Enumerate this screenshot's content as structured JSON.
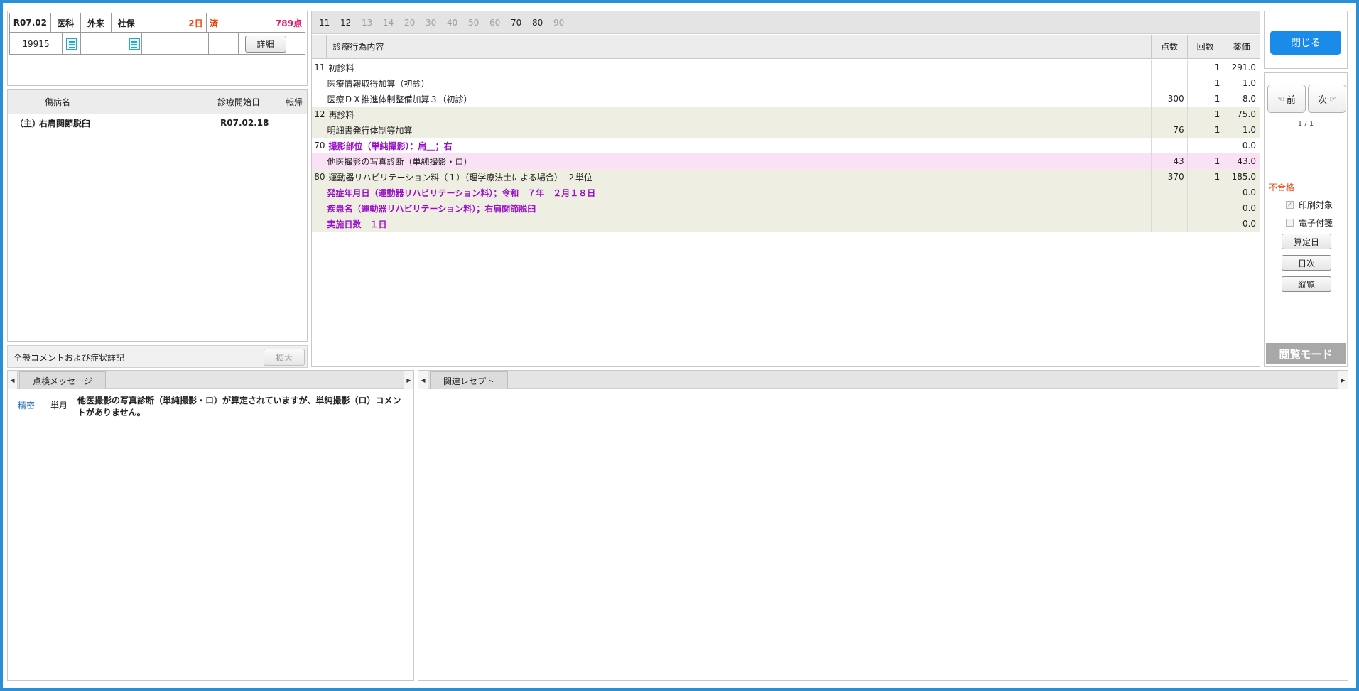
{
  "header": {
    "date": "R07.02",
    "dept": "医科",
    "visit_type": "外来",
    "insurance": "社保",
    "days": "2日",
    "status": "済",
    "points": "789点",
    "patient_id": "19915",
    "detail_label": "詳細"
  },
  "disease": {
    "columns": [
      "傷病名",
      "診療開始日",
      "転帰"
    ],
    "rows": [
      {
        "prefix": "（主）",
        "name": "右肩関節脱臼",
        "start": "R07.02.18",
        "outcome": ""
      }
    ]
  },
  "comment_bar": {
    "label": "全般コメントおよび症状詳記",
    "expand_label": "拡大"
  },
  "main": {
    "tabs": [
      {
        "label": "11",
        "enabled": true
      },
      {
        "label": "12",
        "enabled": true
      },
      {
        "label": "13",
        "enabled": false
      },
      {
        "label": "14",
        "enabled": false
      },
      {
        "label": "20",
        "enabled": false
      },
      {
        "label": "30",
        "enabled": false
      },
      {
        "label": "40",
        "enabled": false
      },
      {
        "label": "50",
        "enabled": false
      },
      {
        "label": "60",
        "enabled": false
      },
      {
        "label": "70",
        "enabled": true
      },
      {
        "label": "80",
        "enabled": true
      },
      {
        "label": "90",
        "enabled": false
      }
    ],
    "columns": {
      "content": "診療行為内容",
      "points": "点数",
      "count": "回数",
      "price": "薬価"
    },
    "rows": [
      {
        "code": "11",
        "name": "初診料",
        "points": "",
        "count": "1",
        "price": "291.0",
        "bg": "white",
        "purple": false
      },
      {
        "code": "",
        "name": "医療情報取得加算（初診）",
        "points": "",
        "count": "1",
        "price": "1.0",
        "bg": "white",
        "purple": false
      },
      {
        "code": "",
        "name": "医療ＤＸ推進体制整備加算３（初診）",
        "points": "300",
        "count": "1",
        "price": "8.0",
        "bg": "white",
        "purple": false
      },
      {
        "code": "12",
        "name": "再診料",
        "points": "",
        "count": "1",
        "price": "75.0",
        "bg": "beige",
        "purple": false
      },
      {
        "code": "",
        "name": "明細書発行体制等加算",
        "points": "76",
        "count": "1",
        "price": "1.0",
        "bg": "beige",
        "purple": false
      },
      {
        "code": "70",
        "name": "撮影部位（単純撮影）：肩＿；右",
        "points": "",
        "count": "",
        "price": "0.0",
        "bg": "white",
        "purple": true
      },
      {
        "code": "",
        "name": "他医撮影の写真診断（単純撮影・ロ）",
        "points": "43",
        "count": "1",
        "price": "43.0",
        "bg": "pink",
        "purple": false
      },
      {
        "code": "80",
        "name": "運動器リハビリテーション料（１）（理学療法士による場合）　２単位",
        "points": "370",
        "count": "1",
        "price": "185.0",
        "bg": "beige",
        "purple": false
      },
      {
        "code": "",
        "name": "発症年月日（運動器リハビリテーション料）；令和　７年　２月１８日",
        "points": "",
        "count": "",
        "price": "0.0",
        "bg": "beige",
        "purple": true
      },
      {
        "code": "",
        "name": "疾患名（運動器リハビリテーション料）；右肩関節脱臼",
        "points": "",
        "count": "",
        "price": "0.0",
        "bg": "beige",
        "purple": true
      },
      {
        "code": "",
        "name": "実施日数　１日",
        "points": "",
        "count": "",
        "price": "0.0",
        "bg": "beige",
        "purple": true
      }
    ]
  },
  "right_panel": {
    "close_label": "閉じる",
    "prev_label": "前",
    "next_label": "次",
    "page": "1 / 1",
    "fail_label": "不合格",
    "print_target_label": "印刷対象",
    "print_target_checked": true,
    "e_tag_label": "電子付箋",
    "e_tag_checked": false,
    "calc_day_label": "算定日",
    "daily_label": "日次",
    "vertical_label": "縦覧",
    "browse_mode_label": "閲覧モード"
  },
  "check_panel": {
    "tab_label": "点検メッセージ",
    "messages": [
      {
        "level": "精密",
        "scope": "単月",
        "text": "他医撮影の写真診断（単純撮影・ロ）が算定されていますが、単純撮影（ロ）コメントがありません。"
      }
    ]
  },
  "related_panel": {
    "tab_label": "関連レセプト"
  },
  "colors": {
    "frame": "#2b8fd6",
    "accent_red": "#e8450a",
    "points_pink": "#e01a6e",
    "purple": "#9a10c8",
    "close_button": "#1a8be8",
    "pink_row": "#fbe1f6",
    "beige_row": "#efeee3"
  }
}
